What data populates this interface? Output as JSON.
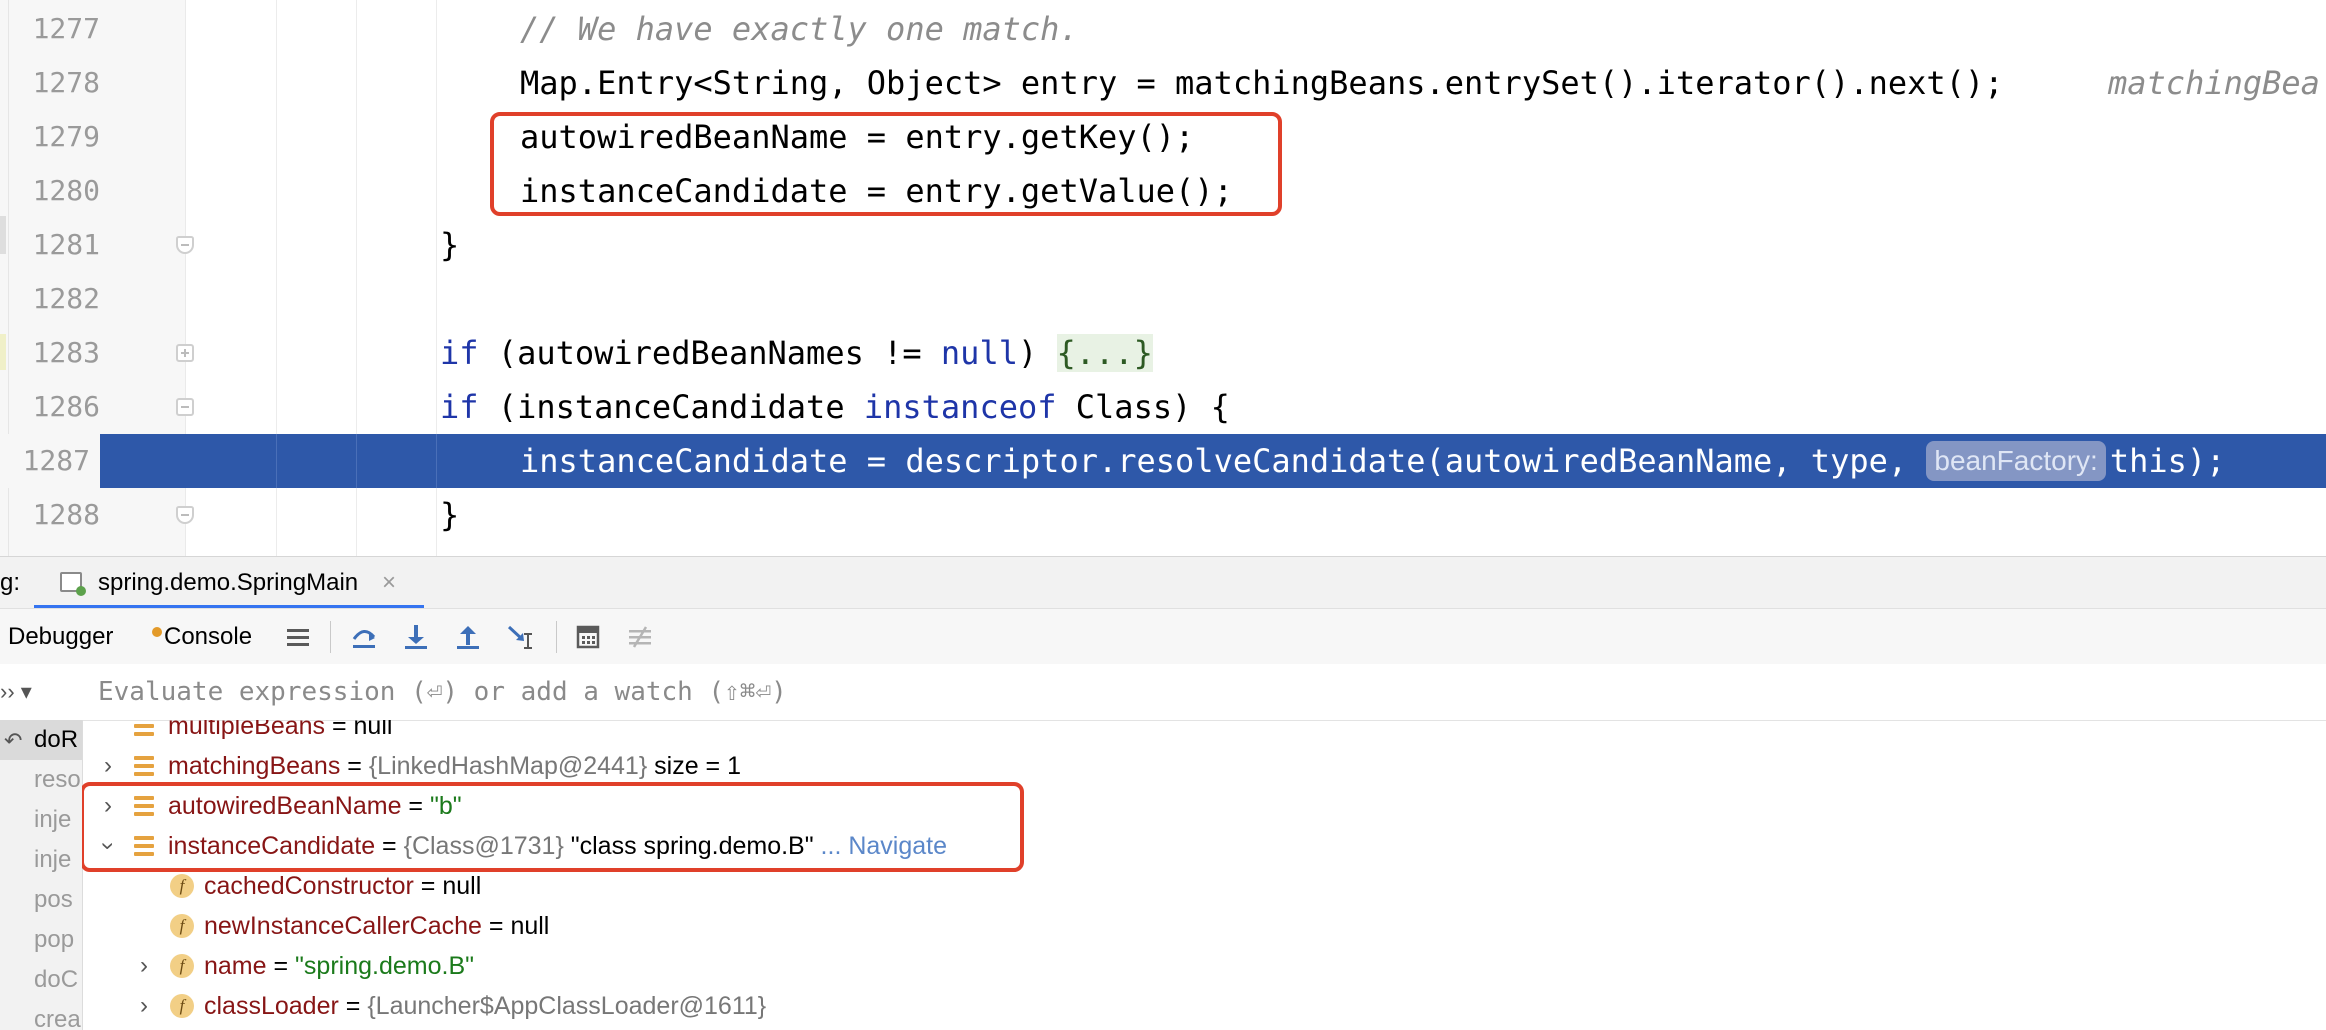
{
  "editor": {
    "lines": [
      {
        "num": "1277",
        "comment": "// We have exactly one match."
      },
      {
        "num": "1278",
        "code": "Map.Entry<String, Object> entry = matchingBeans.entrySet().iterator().next();",
        "hint": "matchingBea"
      },
      {
        "num": "1279",
        "code": "autowiredBeanName = entry.getKey();"
      },
      {
        "num": "1280",
        "code": "instanceCandidate = entry.getValue();"
      },
      {
        "num": "1281",
        "code": "}"
      },
      {
        "num": "1282",
        "code": ""
      },
      {
        "num": "1283",
        "kw1": "if",
        "code": " (autowiredBeanNames != ",
        "kw2": "null",
        "code2": ") ",
        "fold": "{...}"
      },
      {
        "num": "1286",
        "kw1": "if",
        "code": " (instanceCandidate ",
        "kw2": "instanceof",
        "code2": " Class) {"
      },
      {
        "num": "1287",
        "code": "instanceCandidate = descriptor.resolveCandidate(autowiredBeanName, type, ",
        "inlay": "beanFactory:",
        "code2": "this);"
      },
      {
        "num": "1288",
        "code": "}"
      }
    ]
  },
  "debug": {
    "tab_prefix": "g:",
    "run_tab_label": "spring.demo.SpringMain",
    "tab_close": "×",
    "toolbar": {
      "debugger_label": "Debugger",
      "console_label": "Console",
      "icons": [
        "threads-menu-icon",
        "step-over-icon",
        "step-into-icon",
        "step-out-icon",
        "run-to-cursor-icon",
        "evaluate-icon",
        "trace-icon"
      ]
    },
    "eval_left": "›› ▾",
    "eval_placeholder": "Evaluate expression (⏎) or add a watch (⇧⌘⏎)",
    "frames": [
      "doR",
      "reso",
      "inje",
      "inje",
      "pos",
      "pop",
      "doC",
      "crea"
    ],
    "variables": [
      {
        "name": "multipleBeans",
        "eq": " = ",
        "value": "null"
      },
      {
        "name": "matchingBeans",
        "eq": " = ",
        "type": "{LinkedHashMap@2441}",
        "value": " size = 1"
      },
      {
        "name": "autowiredBeanName",
        "eq": " = ",
        "str": "\"b\""
      },
      {
        "name": "instanceCandidate",
        "eq": " = ",
        "type": "{Class@1731}",
        "value": " \"class spring.demo.B\"",
        "nav": " ... Navigate"
      },
      {
        "name": "cachedConstructor",
        "eq": " = ",
        "value": "null"
      },
      {
        "name": "newInstanceCallerCache",
        "eq": " = ",
        "value": "null"
      },
      {
        "name": "name",
        "eq": " = ",
        "str": "\"spring.demo.B\""
      },
      {
        "name": "classLoader",
        "eq": " = ",
        "type": "{Launcher$AppClassLoader@1611}"
      }
    ]
  },
  "colors": {
    "highlight_box": "#e0402a",
    "execution_line": "#2e58a9",
    "keyword": "#1e35a8"
  }
}
